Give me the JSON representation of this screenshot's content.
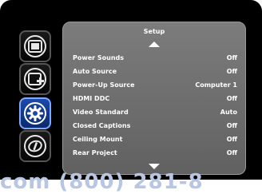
{
  "menu": {
    "title": "Setup",
    "items": [
      {
        "label": "Power Sounds",
        "value": "Off"
      },
      {
        "label": "Auto Source",
        "value": "Off"
      },
      {
        "label": "Power-Up Source",
        "value": "Computer 1"
      },
      {
        "label": "HDMI DDC",
        "value": "Off"
      },
      {
        "label": "Video Standard",
        "value": "Auto"
      },
      {
        "label": "Closed Captions",
        "value": "Off"
      },
      {
        "label": "Ceiling Mount",
        "value": "Off"
      },
      {
        "label": "Rear Project",
        "value": "Off"
      }
    ]
  },
  "sidebar": {
    "icons": [
      "picture-icon",
      "picture-add-icon",
      "gear-icon",
      "info-icon"
    ],
    "active_index": 2
  },
  "watermark": "com (800) 281-8"
}
